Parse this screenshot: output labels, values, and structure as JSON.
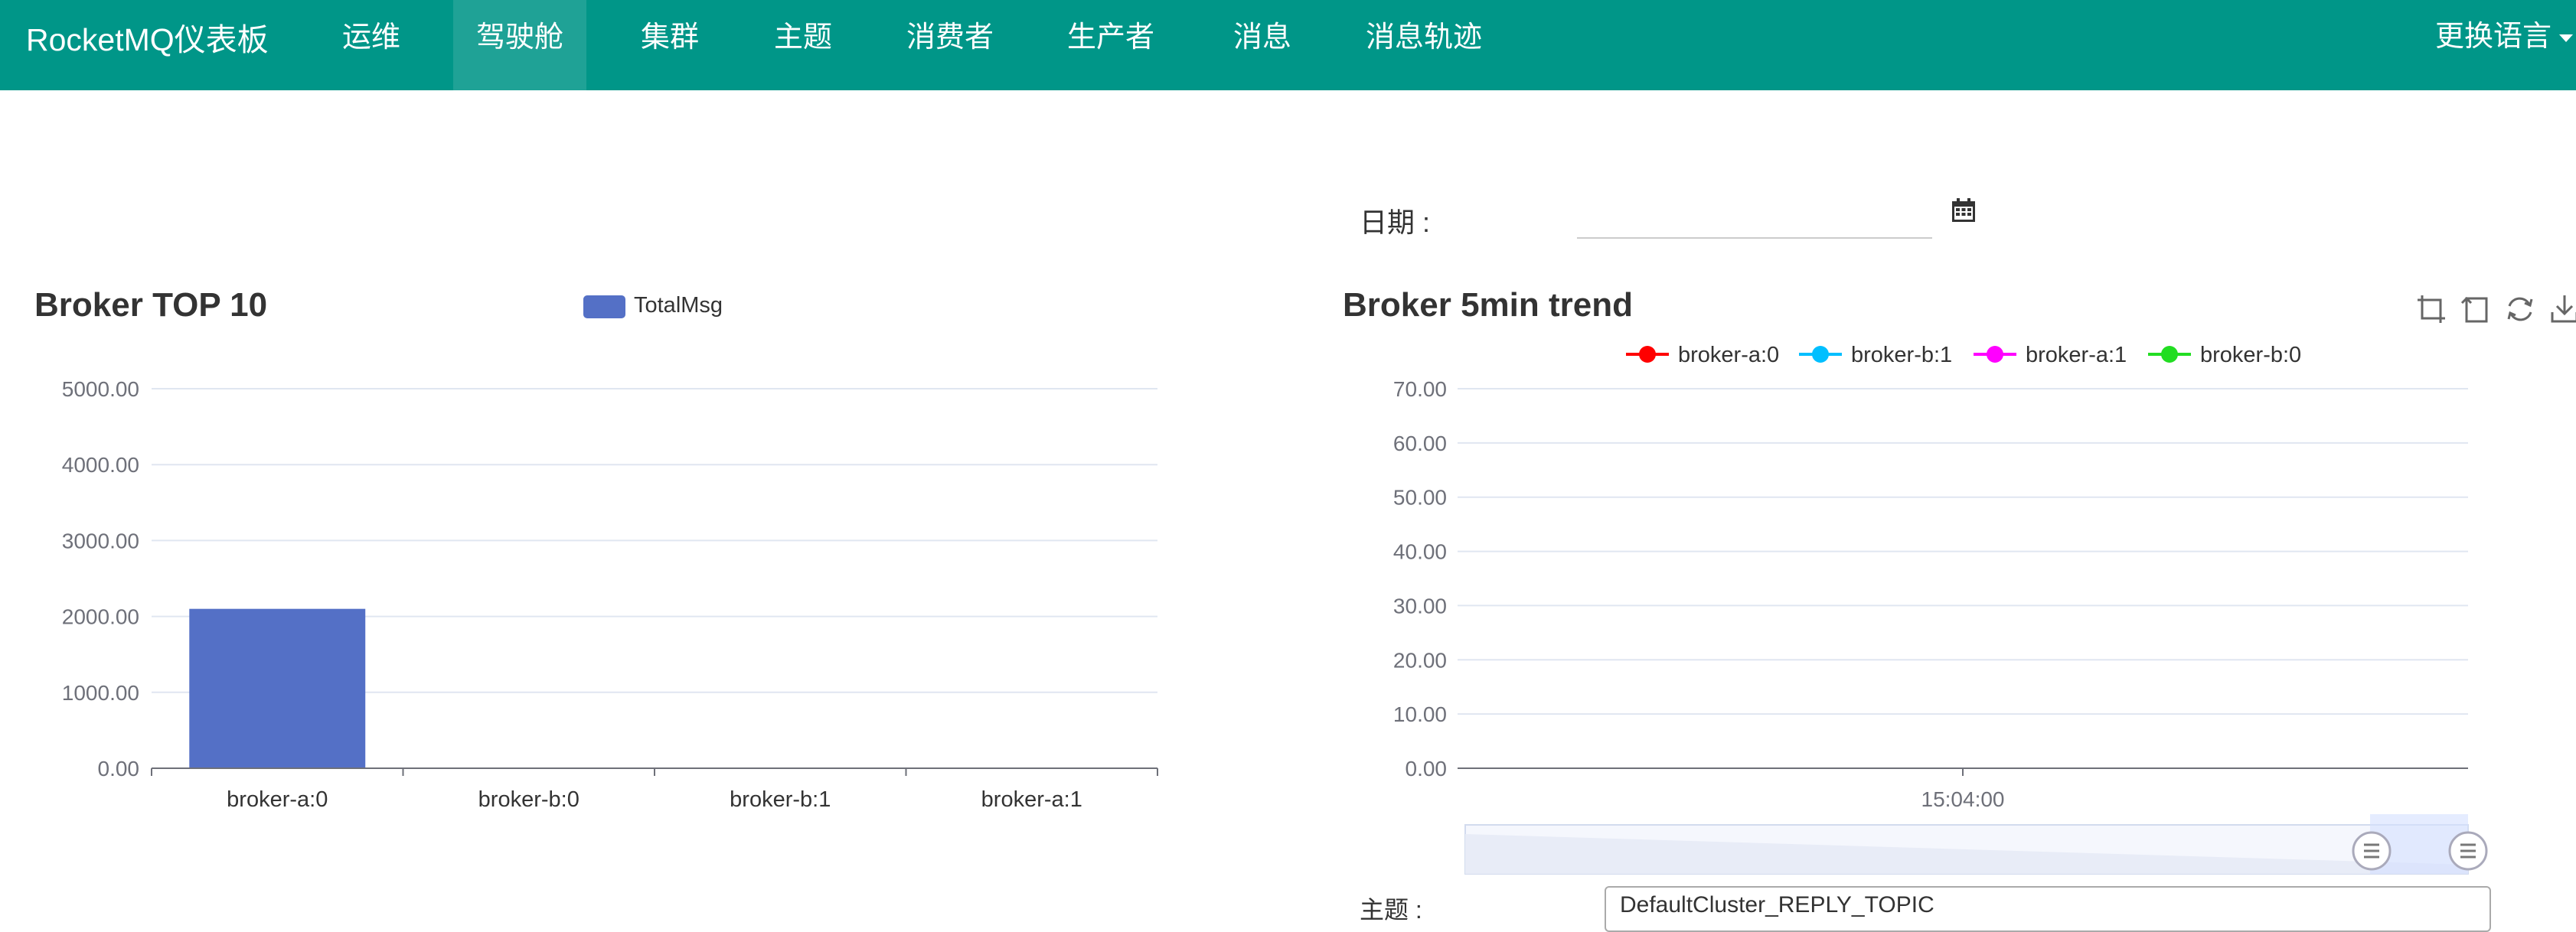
{
  "navbar": {
    "brand": "RocketMQ仪表板",
    "items": [
      {
        "label": "运维",
        "active": false
      },
      {
        "label": "驾驶舱",
        "active": true
      },
      {
        "label": "集群",
        "active": false
      },
      {
        "label": "主题",
        "active": false
      },
      {
        "label": "消费者",
        "active": false
      },
      {
        "label": "生产者",
        "active": false
      },
      {
        "label": "消息",
        "active": false
      },
      {
        "label": "消息轨迹",
        "active": false
      }
    ],
    "language": "更换语言"
  },
  "date_filter": {
    "label": "日期 :",
    "value": "",
    "icon": "calendar-icon"
  },
  "topic_filter": {
    "label": "主题 :",
    "selected": "DefaultCluster_REPLY_TOPIC"
  },
  "toolbox": {
    "icons": [
      "zoom-select-icon",
      "zoom-reset-icon",
      "restore-icon",
      "save-image-icon"
    ]
  },
  "chart_data": [
    {
      "type": "bar",
      "title": "Broker TOP 10",
      "categories": [
        "broker-a:0",
        "broker-b:0",
        "broker-b:1",
        "broker-a:1"
      ],
      "series": [
        {
          "name": "TotalMsg",
          "values": [
            2100,
            0,
            0,
            0
          ],
          "color": "#5470c6"
        }
      ],
      "ylim": [
        0,
        5000
      ],
      "yticks": [
        "0.00",
        "1000.00",
        "2000.00",
        "3000.00",
        "4000.00",
        "5000.00"
      ],
      "grid": true,
      "legend": "top-center"
    },
    {
      "type": "line",
      "title": "Broker 5min trend",
      "x": [
        "15:04:00"
      ],
      "series": [
        {
          "name": "broker-a:0",
          "color": "#ff0000",
          "values": []
        },
        {
          "name": "broker-b:1",
          "color": "#00bfff",
          "values": []
        },
        {
          "name": "broker-a:1",
          "color": "#ff00ff",
          "values": []
        },
        {
          "name": "broker-b:0",
          "color": "#22dd22",
          "values": []
        }
      ],
      "ylim": [
        0,
        70
      ],
      "yticks": [
        "0.00",
        "10.00",
        "20.00",
        "30.00",
        "40.00",
        "50.00",
        "60.00",
        "70.00"
      ],
      "grid": true,
      "legend": "top-center",
      "datazoom_range": [
        0.9,
        1.0
      ]
    }
  ]
}
